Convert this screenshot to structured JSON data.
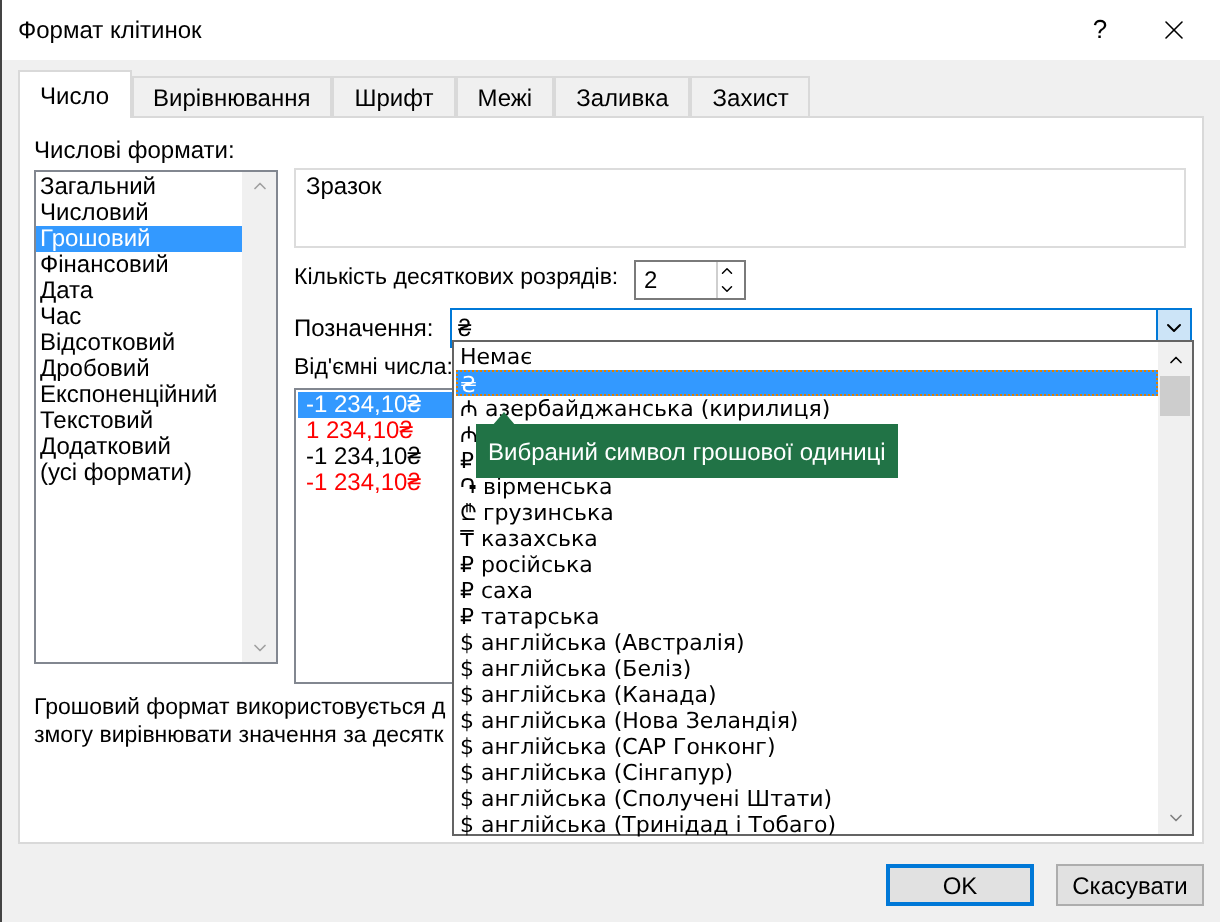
{
  "window": {
    "title": "Формат клітинок",
    "help": "?"
  },
  "tabs": [
    {
      "label": "Число",
      "selected": true
    },
    {
      "label": "Вирівнювання",
      "selected": false
    },
    {
      "label": "Шрифт",
      "selected": false
    },
    {
      "label": "Межі",
      "selected": false
    },
    {
      "label": "Заливка",
      "selected": false
    },
    {
      "label": "Захист",
      "selected": false
    }
  ],
  "formats": {
    "label": "Числові формати:",
    "items": [
      {
        "label": "Загальний",
        "selected": false
      },
      {
        "label": "Числовий",
        "selected": false
      },
      {
        "label": "Грошовий",
        "selected": true
      },
      {
        "label": "Фінансовий",
        "selected": false
      },
      {
        "label": "Дата",
        "selected": false
      },
      {
        "label": "Час",
        "selected": false
      },
      {
        "label": "Відсотковий",
        "selected": false
      },
      {
        "label": "Дробовий",
        "selected": false
      },
      {
        "label": "Експоненційний",
        "selected": false
      },
      {
        "label": "Текстовий",
        "selected": false
      },
      {
        "label": "Додатковий",
        "selected": false
      },
      {
        "label": "(усі формати)",
        "selected": false
      }
    ]
  },
  "sample": {
    "label": "Зразок"
  },
  "decimal_places": {
    "label": "Кількість десяткових розрядів:",
    "value": "2"
  },
  "symbol": {
    "label": "Позначення:",
    "value": "₴",
    "expanded": true
  },
  "negative_numbers": {
    "label": "Від'ємні числа:",
    "items": [
      {
        "text": "-1 234,10₴",
        "red": false,
        "selected": true
      },
      {
        "text": "1 234,10₴",
        "red": true,
        "selected": false
      },
      {
        "text": "-1 234,10₴",
        "red": false,
        "selected": false
      },
      {
        "text": "-1 234,10₴",
        "red": true,
        "selected": false
      }
    ]
  },
  "description": [
    "Грошовий формат використовується д",
    "змогу вирівнювати значення за десятк"
  ],
  "symbol_dropdown": {
    "items": [
      {
        "label": "Немає",
        "selected": false
      },
      {
        "label": "₴",
        "selected": true
      },
      {
        "label": "₼ азербайджанська (кирилиця)",
        "selected": false
      },
      {
        "label": "₼",
        "selected": false
      },
      {
        "label": "₽",
        "selected": false
      },
      {
        "label": "֏ вірменська",
        "selected": false
      },
      {
        "label": "₾ грузинська",
        "selected": false
      },
      {
        "label": "₸ казахська",
        "selected": false
      },
      {
        "label": "₽ російська",
        "selected": false
      },
      {
        "label": "₽ саха",
        "selected": false
      },
      {
        "label": "₽ татарська",
        "selected": false
      },
      {
        "label": "$ англійська (Австралія)",
        "selected": false
      },
      {
        "label": "$ англійська (Беліз)",
        "selected": false
      },
      {
        "label": "$ англійська (Канада)",
        "selected": false
      },
      {
        "label": "$ англійська (Нова Зеландія)",
        "selected": false
      },
      {
        "label": "$ англійська (САР Гонконг)",
        "selected": false
      },
      {
        "label": "$ англійська (Сінгапур)",
        "selected": false
      },
      {
        "label": "$ англійська (Сполучені Штати)",
        "selected": false
      },
      {
        "label": "$ англійська (Тринідад і Тобаго)",
        "selected": false
      }
    ]
  },
  "tooltip": "Вибраний символ грошової одиниці",
  "buttons": [
    "OK",
    "Скасувати"
  ]
}
